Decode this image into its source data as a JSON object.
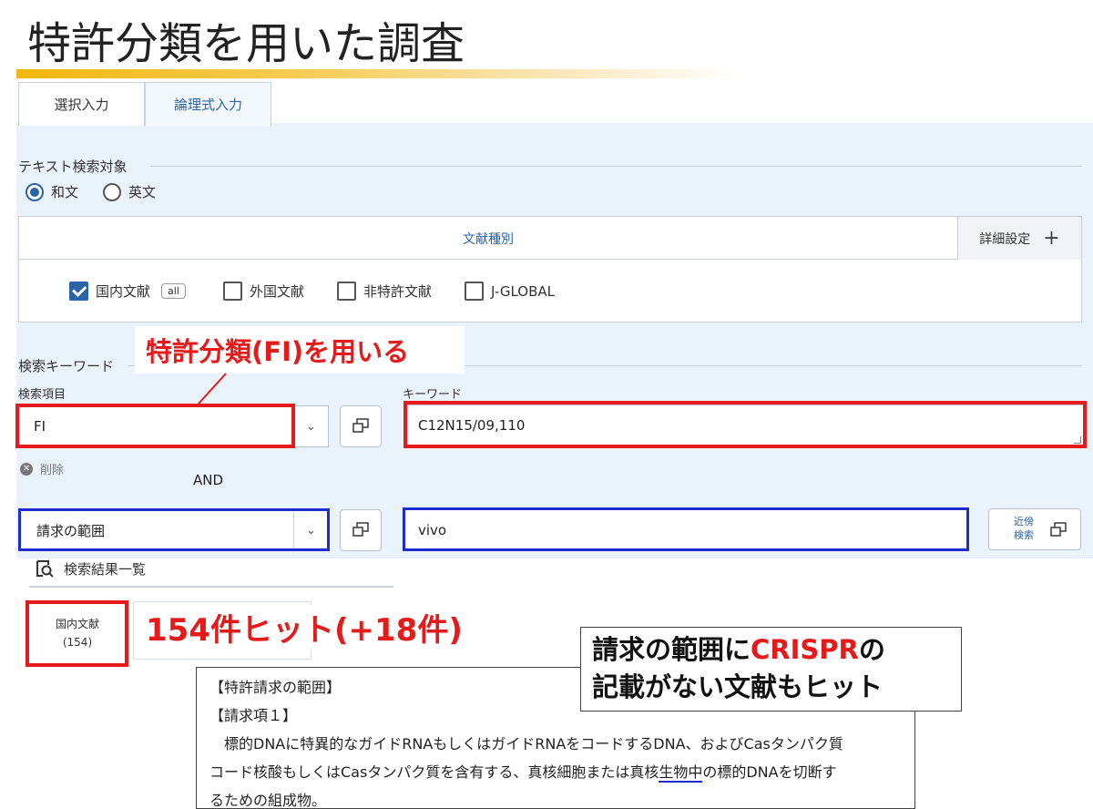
{
  "slide": {
    "title": "特許分類を用いた調査"
  },
  "tabs": [
    {
      "label": "選択入力",
      "active": true
    },
    {
      "label": "論理式入力",
      "active": false
    }
  ],
  "text_target": {
    "label": "テキスト検索対象",
    "options": [
      {
        "label": "和文",
        "selected": true
      },
      {
        "label": "英文",
        "selected": false
      }
    ]
  },
  "doc_types": {
    "title": "文献種別",
    "detail_label": "詳細設定",
    "items": [
      {
        "label": "国内文献",
        "checked": true,
        "badge": "all"
      },
      {
        "label": "外国文献",
        "checked": false
      },
      {
        "label": "非特許文献",
        "checked": false
      },
      {
        "label": "J-GLOBAL",
        "checked": false
      }
    ]
  },
  "keywords": {
    "section_label": "検索キーワード",
    "field_label": "検索項目",
    "keyword_label": "キーワード",
    "row1": {
      "field": "FI",
      "value": "C12N15/09,110"
    },
    "delete_label": "削除",
    "operator": "AND",
    "row2": {
      "field": "請求の範囲",
      "value": "vivo"
    },
    "near_search_label_1": "近傍",
    "near_search_label_2": "検索"
  },
  "results": {
    "tab_label": "検索結果一覧",
    "card_label": "国内文献",
    "card_count": "(154)"
  },
  "annotations": {
    "fi_callout": "特許分類(FI)を用いる",
    "hit_text": "154件ヒット(+18件)",
    "note_line1_prefix": "請求の範囲に",
    "note_line1_highlight": "CRISPR",
    "note_line1_suffix": "の",
    "note_line2": "記載がない文献もヒット"
  },
  "claim_excerpt": {
    "heading": "【特許請求の範囲】",
    "claim_no": "【請求項１】",
    "line1": "標的DNAに特異的なガイドRNAもしくはガイドRNAをコードするDNA、およびCasタンパク質",
    "line2_a": "コード核酸もしくはCasタンパク質を含有する、真核細胞または真核",
    "line2_underline": "生物中",
    "line2_b": "の標的DNAを切断す",
    "line3": "るための組成物。"
  },
  "colors": {
    "accent_blue": "#2a63a8",
    "highlight_red": "#e51a1a",
    "frame_blue": "#1d2bd0",
    "panel_bg": "#eaf2fb",
    "title_rule": "#f2b70f"
  }
}
